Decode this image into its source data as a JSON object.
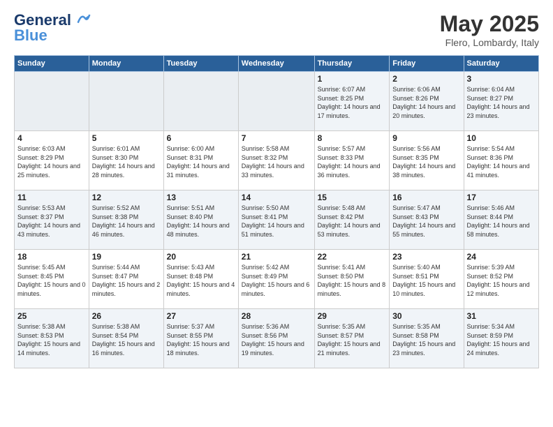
{
  "header": {
    "logo_line1": "General",
    "logo_line2": "Blue",
    "month_title": "May 2025",
    "location": "Flero, Lombardy, Italy"
  },
  "weekdays": [
    "Sunday",
    "Monday",
    "Tuesday",
    "Wednesday",
    "Thursday",
    "Friday",
    "Saturday"
  ],
  "weeks": [
    [
      {
        "day": "",
        "info": ""
      },
      {
        "day": "",
        "info": ""
      },
      {
        "day": "",
        "info": ""
      },
      {
        "day": "",
        "info": ""
      },
      {
        "day": "1",
        "info": "Sunrise: 6:07 AM\nSunset: 8:25 PM\nDaylight: 14 hours\nand 17 minutes."
      },
      {
        "day": "2",
        "info": "Sunrise: 6:06 AM\nSunset: 8:26 PM\nDaylight: 14 hours\nand 20 minutes."
      },
      {
        "day": "3",
        "info": "Sunrise: 6:04 AM\nSunset: 8:27 PM\nDaylight: 14 hours\nand 23 minutes."
      }
    ],
    [
      {
        "day": "4",
        "info": "Sunrise: 6:03 AM\nSunset: 8:29 PM\nDaylight: 14 hours\nand 25 minutes."
      },
      {
        "day": "5",
        "info": "Sunrise: 6:01 AM\nSunset: 8:30 PM\nDaylight: 14 hours\nand 28 minutes."
      },
      {
        "day": "6",
        "info": "Sunrise: 6:00 AM\nSunset: 8:31 PM\nDaylight: 14 hours\nand 31 minutes."
      },
      {
        "day": "7",
        "info": "Sunrise: 5:58 AM\nSunset: 8:32 PM\nDaylight: 14 hours\nand 33 minutes."
      },
      {
        "day": "8",
        "info": "Sunrise: 5:57 AM\nSunset: 8:33 PM\nDaylight: 14 hours\nand 36 minutes."
      },
      {
        "day": "9",
        "info": "Sunrise: 5:56 AM\nSunset: 8:35 PM\nDaylight: 14 hours\nand 38 minutes."
      },
      {
        "day": "10",
        "info": "Sunrise: 5:54 AM\nSunset: 8:36 PM\nDaylight: 14 hours\nand 41 minutes."
      }
    ],
    [
      {
        "day": "11",
        "info": "Sunrise: 5:53 AM\nSunset: 8:37 PM\nDaylight: 14 hours\nand 43 minutes."
      },
      {
        "day": "12",
        "info": "Sunrise: 5:52 AM\nSunset: 8:38 PM\nDaylight: 14 hours\nand 46 minutes."
      },
      {
        "day": "13",
        "info": "Sunrise: 5:51 AM\nSunset: 8:40 PM\nDaylight: 14 hours\nand 48 minutes."
      },
      {
        "day": "14",
        "info": "Sunrise: 5:50 AM\nSunset: 8:41 PM\nDaylight: 14 hours\nand 51 minutes."
      },
      {
        "day": "15",
        "info": "Sunrise: 5:48 AM\nSunset: 8:42 PM\nDaylight: 14 hours\nand 53 minutes."
      },
      {
        "day": "16",
        "info": "Sunrise: 5:47 AM\nSunset: 8:43 PM\nDaylight: 14 hours\nand 55 minutes."
      },
      {
        "day": "17",
        "info": "Sunrise: 5:46 AM\nSunset: 8:44 PM\nDaylight: 14 hours\nand 58 minutes."
      }
    ],
    [
      {
        "day": "18",
        "info": "Sunrise: 5:45 AM\nSunset: 8:45 PM\nDaylight: 15 hours\nand 0 minutes."
      },
      {
        "day": "19",
        "info": "Sunrise: 5:44 AM\nSunset: 8:47 PM\nDaylight: 15 hours\nand 2 minutes."
      },
      {
        "day": "20",
        "info": "Sunrise: 5:43 AM\nSunset: 8:48 PM\nDaylight: 15 hours\nand 4 minutes."
      },
      {
        "day": "21",
        "info": "Sunrise: 5:42 AM\nSunset: 8:49 PM\nDaylight: 15 hours\nand 6 minutes."
      },
      {
        "day": "22",
        "info": "Sunrise: 5:41 AM\nSunset: 8:50 PM\nDaylight: 15 hours\nand 8 minutes."
      },
      {
        "day": "23",
        "info": "Sunrise: 5:40 AM\nSunset: 8:51 PM\nDaylight: 15 hours\nand 10 minutes."
      },
      {
        "day": "24",
        "info": "Sunrise: 5:39 AM\nSunset: 8:52 PM\nDaylight: 15 hours\nand 12 minutes."
      }
    ],
    [
      {
        "day": "25",
        "info": "Sunrise: 5:38 AM\nSunset: 8:53 PM\nDaylight: 15 hours\nand 14 minutes."
      },
      {
        "day": "26",
        "info": "Sunrise: 5:38 AM\nSunset: 8:54 PM\nDaylight: 15 hours\nand 16 minutes."
      },
      {
        "day": "27",
        "info": "Sunrise: 5:37 AM\nSunset: 8:55 PM\nDaylight: 15 hours\nand 18 minutes."
      },
      {
        "day": "28",
        "info": "Sunrise: 5:36 AM\nSunset: 8:56 PM\nDaylight: 15 hours\nand 19 minutes."
      },
      {
        "day": "29",
        "info": "Sunrise: 5:35 AM\nSunset: 8:57 PM\nDaylight: 15 hours\nand 21 minutes."
      },
      {
        "day": "30",
        "info": "Sunrise: 5:35 AM\nSunset: 8:58 PM\nDaylight: 15 hours\nand 23 minutes."
      },
      {
        "day": "31",
        "info": "Sunrise: 5:34 AM\nSunset: 8:59 PM\nDaylight: 15 hours\nand 24 minutes."
      }
    ]
  ]
}
